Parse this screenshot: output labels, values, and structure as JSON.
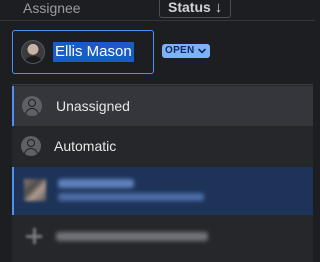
{
  "header": {
    "assignee_label": "Assignee",
    "status_label": "Status",
    "status_sort_icon": "arrow-down-icon"
  },
  "assignee_field": {
    "value": "Ellis Mason",
    "avatar_icon": "user-avatar"
  },
  "status_badge": {
    "label": "OPEN",
    "icon": "chevron-down-icon"
  },
  "dropdown": {
    "items": [
      {
        "label": "Unassigned",
        "icon": "person-icon"
      },
      {
        "label": "Automatic",
        "icon": "person-icon"
      },
      {
        "label": "",
        "icon": "user-avatar",
        "note": "blurred"
      },
      {
        "label": "",
        "icon": "plus-icon",
        "note": "blurred"
      }
    ]
  },
  "colors": {
    "background": "#1d1e21",
    "accent": "#4d92f0",
    "selection": "#1a5cc6",
    "badge": "#7fb2f5",
    "highlight_row": "#1d3358"
  }
}
